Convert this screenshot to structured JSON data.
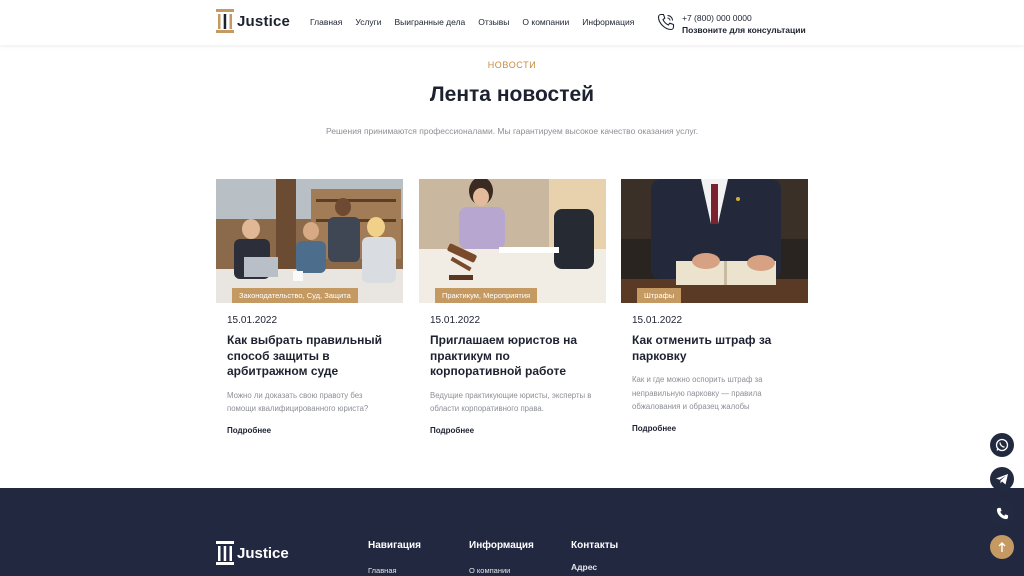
{
  "header": {
    "logo_text": "Justice",
    "nav": [
      "Главная",
      "Услуги",
      "Выигранные дела",
      "Отзывы",
      "О компании",
      "Информация"
    ],
    "phone_number": "+7 (800) 000 0000",
    "phone_caption": "Позвоните для консультации"
  },
  "section": {
    "eyebrow": "НОВОСТИ",
    "title": "Лента новостей",
    "description": "Решения принимаются профессионалами. Мы гарантируем высокое качество оказания услуг."
  },
  "cards": [
    {
      "tag": "Законодательство, Суд, Защита",
      "date": "15.01.2022",
      "title": "Как выбрать правильный способ защиты в арбитражном суде",
      "text": "Можно ли доказать свою правоту без помощи квалифицированного юриста?",
      "more": "Подробнее"
    },
    {
      "tag": "Практикум, Мероприятия",
      "date": "15.01.2022",
      "title": "Приглашаем юристов на практикум по корпоративной работе",
      "text": "Ведущие практикующие юристы, эксперты в области корпоративного права.",
      "more": "Подробнее"
    },
    {
      "tag": "Штрафы",
      "date": "15.01.2022",
      "title": "Как отменить штраф за парковку",
      "text": "Как и где можно оспорить штраф за неправильную парковку — правила обжалования и образец жалобы",
      "more": "Подробнее"
    }
  ],
  "floating": [
    "whatsapp-icon",
    "telegram-icon",
    "phone-icon",
    "arrow-up-icon"
  ],
  "footer": {
    "logo_text": "Justice",
    "columns": [
      {
        "heading": "Навигация",
        "first": "Главная"
      },
      {
        "heading": "Информация",
        "first": "О компании"
      },
      {
        "heading": "Контакты",
        "first": "Адрес"
      }
    ]
  },
  "colors": {
    "accent": "#c98a3d",
    "tag_bg": "#c59a62",
    "footer_bg": "#222840",
    "text_dark": "#1d2230",
    "text_muted": "#8c8f96"
  }
}
